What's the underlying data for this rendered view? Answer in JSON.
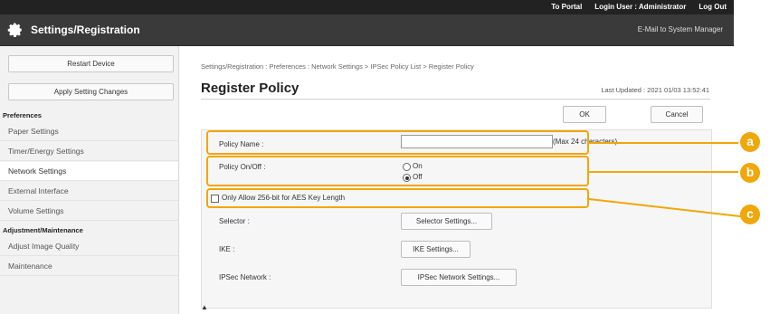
{
  "topbar": {
    "portal": "To Portal",
    "login_user": "Login User : Administrator",
    "logout": "Log Out"
  },
  "header": {
    "title": "Settings/Registration",
    "mail": "E-Mail to System Manager"
  },
  "sidebar": {
    "restart": "Restart Device",
    "apply": "Apply Setting Changes",
    "section_preferences": "Preferences",
    "items_pref": [
      "Paper Settings",
      "Timer/Energy Settings",
      "Network Settings",
      "External Interface",
      "Volume Settings"
    ],
    "section_adjust": "Adjustment/Maintenance",
    "items_adjust": [
      "Adjust Image Quality",
      "Maintenance"
    ]
  },
  "main": {
    "breadcrumb": "Settings/Registration : Preferences : Network Settings > IPSec Policy List > Register Policy",
    "title": "Register Policy",
    "last_updated": "Last Updated : 2021 01/03 13:52:41",
    "ok": "OK",
    "cancel": "Cancel",
    "policy_name_label": "Policy Name :",
    "policy_name_value": "",
    "max_chars": "(Max 24 characters)",
    "policy_onoff_label": "Policy On/Off :",
    "on_label": "On",
    "off_label": "Off",
    "only_allow_label": "Only Allow 256-bit for AES Key Length",
    "selector_label": "Selector :",
    "selector_btn": "Selector Settings...",
    "ike_label": "IKE :",
    "ike_btn": "IKE Settings...",
    "ipsec_label": "IPSec Network :",
    "ipsec_btn": "IPSec Network Settings...",
    "bottom_mark": "▲"
  },
  "callouts": [
    "a",
    "b",
    "c"
  ],
  "colors": {
    "accent": "#f0a70a",
    "topbar": "#222222",
    "header": "#3a3a3a"
  }
}
